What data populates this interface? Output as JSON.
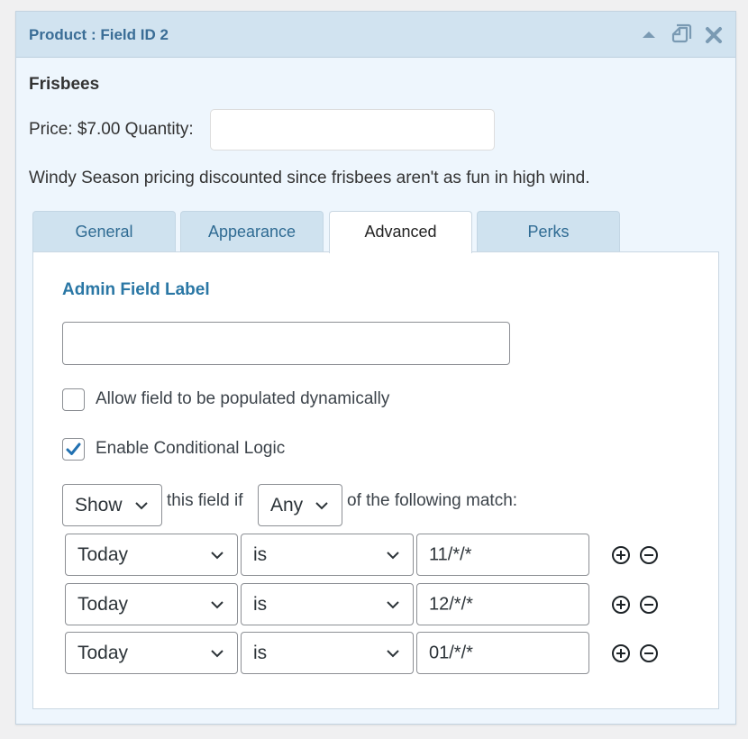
{
  "panel": {
    "title": "Product : Field ID 2",
    "icons": [
      "collapse-up-icon",
      "duplicate-icon",
      "close-icon"
    ]
  },
  "product": {
    "name": "Frisbees",
    "price_text": "Price: $7.00 Quantity:",
    "quantity_value": "",
    "description": "Windy Season pricing discounted since frisbees aren't as fun in high wind."
  },
  "tabs": [
    {
      "label": "General",
      "active": false
    },
    {
      "label": "Appearance",
      "active": false
    },
    {
      "label": "Advanced",
      "active": true
    },
    {
      "label": "Perks",
      "active": false
    }
  ],
  "advanced": {
    "admin_field_label": "Admin Field Label",
    "admin_field_value": "",
    "populate_dynamically": {
      "label": "Allow field to be populated dynamically",
      "checked": false
    },
    "conditional_logic": {
      "label": "Enable Conditional Logic",
      "checked": true
    }
  },
  "logic": {
    "action": "Show",
    "text_1": "this field if",
    "match": "Any",
    "text_2": "of the following match:",
    "rules": [
      {
        "field": "Today",
        "operator": "is",
        "value": "11/*/*"
      },
      {
        "field": "Today",
        "operator": "is",
        "value": "12/*/*"
      },
      {
        "field": "Today",
        "operator": "is",
        "value": "01/*/*"
      }
    ]
  },
  "colors": {
    "header_bg": "#d1e3f0",
    "title": "#3a6d96",
    "accent": "#2a77a5",
    "checkbox_check": "#2271b1"
  }
}
